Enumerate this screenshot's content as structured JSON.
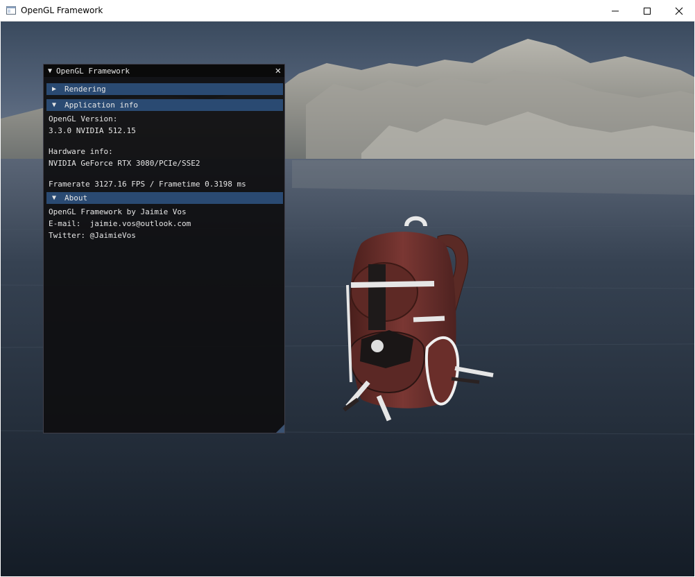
{
  "window": {
    "title": "OpenGL Framework",
    "minimize_label": "",
    "maximize_label": "",
    "close_label": ""
  },
  "imgui": {
    "title": "OpenGL Framework",
    "sections": [
      {
        "label": "Rendering",
        "expanded": false
      },
      {
        "label": "Application info",
        "expanded": true
      },
      {
        "label": "About",
        "expanded": true
      }
    ],
    "app_info": {
      "opengl_label": "OpenGL Version:",
      "opengl_value": "3.3.0 NVIDIA 512.15",
      "hardware_label": "Hardware info:",
      "hardware_value": "NVIDIA GeForce RTX 3080/PCIe/SSE2",
      "framerate": "Framerate 3127.16 FPS / Frametime 0.3198 ms"
    },
    "about": {
      "line1": "OpenGL Framework by Jaimie Vos",
      "line2": "E-mail:  jaimie.vos@outlook.com",
      "line3": "Twitter: @JaimieVos"
    }
  },
  "colors": {
    "header_bg": "#2a4a72",
    "panel_bg": "#0f0f11",
    "backpack": "#6b2e2a"
  }
}
